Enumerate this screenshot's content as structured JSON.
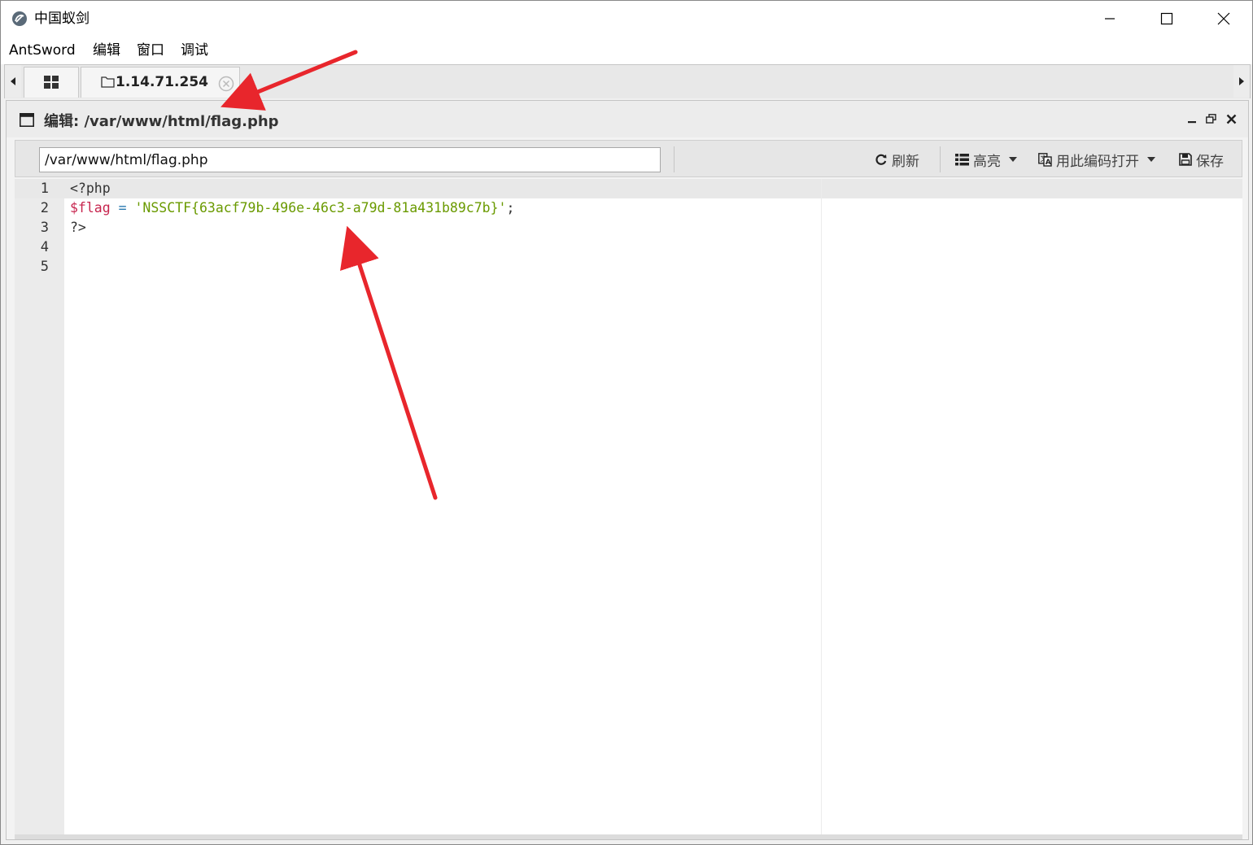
{
  "window": {
    "title": "中国蚁剑",
    "controls": [
      "minimize-icon",
      "maximize-icon",
      "close-icon"
    ]
  },
  "menu": {
    "items": [
      "AntSword",
      "编辑",
      "窗口",
      "调试"
    ]
  },
  "tabs": {
    "home_icon": "grid-icon",
    "active": {
      "icon": "folder-icon",
      "label": "1.14.71.254",
      "close_icon": "circle-close-icon"
    }
  },
  "panel": {
    "title": "编辑: /var/www/html/flag.php",
    "controls": [
      "minimize-icon",
      "restore-icon",
      "close-icon"
    ]
  },
  "toolbar": {
    "path_value": "/var/www/html/flag.php",
    "refresh_label": "刷新",
    "highlight_label": "高亮",
    "open_with_encoding_label": "用此编码打开",
    "save_label": "保存"
  },
  "editor": {
    "line_numbers": [
      "1",
      "2",
      "3",
      "4",
      "5"
    ],
    "active_line": 1,
    "lines": {
      "l1": "<?php",
      "l2_var": "$flag",
      "l2_op": " = ",
      "l2_str": "'NSSCTF{63acf79b-496e-46c3-a79d-81a431b89c7b}'",
      "l2_end": ";",
      "l3": "?>",
      "l4": "",
      "l5": ""
    }
  },
  "colors": {
    "annotation_arrow": "#e8262c",
    "php_variable": "#c7254e",
    "php_string": "#6a9a00",
    "php_operator": "#2a7ab0"
  }
}
